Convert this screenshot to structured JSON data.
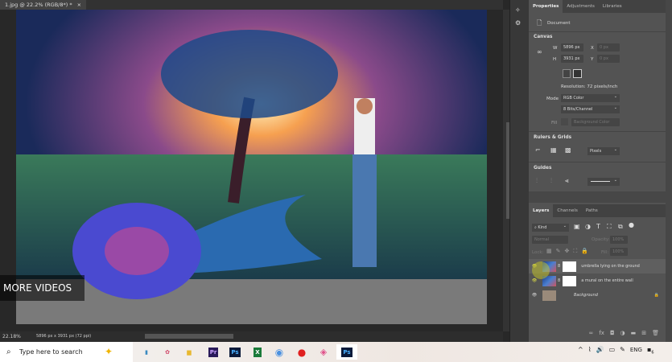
{
  "document": {
    "tab_title": "1.jpg @ 22.2% (RGB/8*) *",
    "close_icon": "×"
  },
  "status": {
    "zoom": "22.18%",
    "info": "5896 px x 3931 px (72 ppi)"
  },
  "overlay": {
    "text": "MORE VIDEOS"
  },
  "properties": {
    "tabs": [
      "Properties",
      "Adjustments",
      "Libraries"
    ],
    "doc_label": "Document",
    "canvas_header": "Canvas",
    "w_label": "W",
    "w_value": "5896 px",
    "x_label": "X",
    "x_value": "0 px",
    "h_label": "H",
    "h_value": "3931 px",
    "y_label": "Y",
    "y_value": "0 px",
    "resolution": "Resolution: 72 pixels/inch",
    "mode_label": "Mode",
    "mode_value": "RGB Color",
    "bits_value": "8 Bits/Channel",
    "fill_label": "Fill",
    "fill_value": "Background Color",
    "rulers_header": "Rulers & Grids",
    "units": "Pixels",
    "guides_header": "Guides"
  },
  "layers": {
    "tabs": [
      "Layers",
      "Channels",
      "Paths"
    ],
    "kind": "Kind",
    "blend": "Normal",
    "opacity_label": "Opacity:",
    "opacity": "100%",
    "lock_label": "Lock:",
    "fill_label": "Fill:",
    "fill": "100%",
    "items": [
      {
        "name": "umbrella lying on the ground",
        "visible": true
      },
      {
        "name": "a mural on the entire wall",
        "visible": true
      },
      {
        "name": "Background",
        "visible": true,
        "locked": true
      }
    ]
  },
  "taskbar": {
    "search_placeholder": "Type here to search",
    "apps": [
      "Files",
      "Paint",
      "File Explorer",
      "Pr",
      "Ps",
      "X",
      "Chrome",
      "Record",
      "Photos",
      "Ps"
    ],
    "lang": "ENG",
    "notifications": "6"
  }
}
